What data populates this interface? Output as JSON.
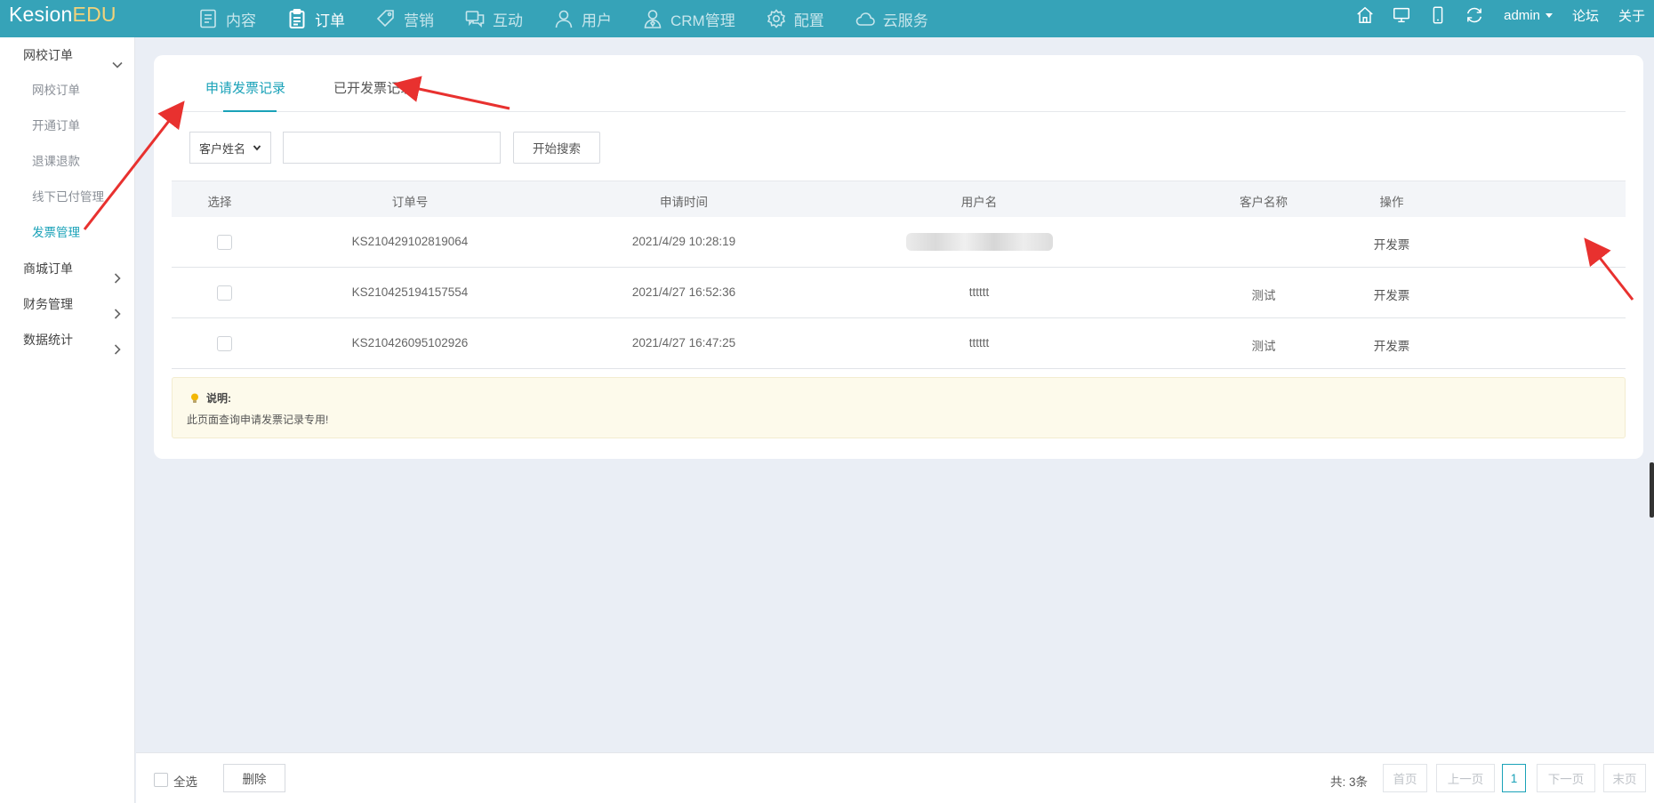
{
  "app": {
    "logo_main": "Kesion",
    "logo_accent": "EDU"
  },
  "nav": [
    {
      "label": "内容",
      "icon": "document-icon",
      "active": false
    },
    {
      "label": "订单",
      "icon": "clipboard-icon",
      "active": true
    },
    {
      "label": "营销",
      "icon": "tag-icon",
      "active": false
    },
    {
      "label": "互动",
      "icon": "chat-icon",
      "active": false
    },
    {
      "label": "用户",
      "icon": "user-icon",
      "active": false
    },
    {
      "label": "CRM管理",
      "icon": "crm-user-icon",
      "active": false
    },
    {
      "label": "配置",
      "icon": "gear-icon",
      "active": false
    },
    {
      "label": "云服务",
      "icon": "cloud-icon",
      "active": false
    }
  ],
  "topright": {
    "user": "admin",
    "forum": "论坛",
    "about": "关于"
  },
  "sidebar": {
    "group1": "网校订单",
    "subitems": [
      "网校订单",
      "开通订单",
      "退课退款",
      "线下已付管理",
      "发票管理"
    ],
    "group2": "商城订单",
    "group3": "财务管理",
    "group4": "数据统计"
  },
  "tabs": {
    "apply": "申请发票记录",
    "issued": "已开发票记录"
  },
  "search": {
    "select_value": "客户姓名",
    "input_value": "",
    "button": "开始搜索"
  },
  "table": {
    "headers": [
      "选择",
      "订单号",
      "申请时间",
      "用户名",
      "客户名称",
      "操作"
    ],
    "rows": [
      {
        "order": "KS210429102819064",
        "time": "2021/4/29 10:28:19",
        "user": "",
        "customer": "",
        "action": "开发票"
      },
      {
        "order": "KS210425194157554",
        "time": "2021/4/27 16:52:36",
        "user": "tttttt",
        "customer": "测试",
        "action": "开发票"
      },
      {
        "order": "KS210426095102926",
        "time": "2021/4/27 16:47:25",
        "user": "tttttt",
        "customer": "测试",
        "action": "开发票"
      }
    ]
  },
  "note": {
    "title": "说明:",
    "text": "此页面查询申请发票记录专用!"
  },
  "footer": {
    "select_all": "全选",
    "delete": "删除",
    "total": "共: 3条",
    "first": "首页",
    "prev": "上一页",
    "current": "1",
    "next": "下一页",
    "last": "末页"
  },
  "colors": {
    "topbar": "#36a3b8",
    "accent": "#1aa2b8",
    "annotation_arrow": "#e8312f"
  }
}
